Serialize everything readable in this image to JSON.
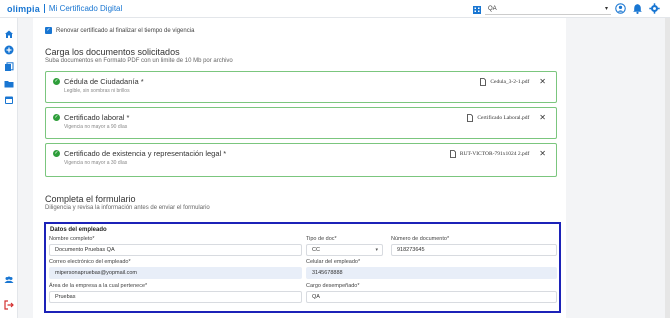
{
  "header": {
    "logo": "olimpia",
    "app_title": "Mi Certificado Digital",
    "tenant": "QA"
  },
  "renew": {
    "label": "Renovar certificado al finalizar el tiempo de vigencia",
    "checked": true
  },
  "upload": {
    "title": "Carga los documentos solicitados",
    "subtitle": "Suba documentos en Formato PDF con un limite de 10 Mb por archivo",
    "documents": [
      {
        "title": "Cédula de Ciudadanía *",
        "hint": "Legible, sin sombras ni brillos",
        "file": "Cedula_3-2-1.pdf"
      },
      {
        "title": "Certificado laboral *",
        "hint": "Vigencia no mayor a 90 días",
        "file": "Certificado Laboral.pdf"
      },
      {
        "title": "Certificado de existencia y representación legal *",
        "hint": "Vigencia no mayor a 30 días",
        "file": "RUT-VICTOR-791x1024 2.pdf"
      }
    ]
  },
  "form": {
    "title": "Completa el formulario",
    "subtitle": "Diligencia y revisa la información antes de enviar el formulario",
    "section": "Datos del empleado",
    "fields": {
      "full_name": {
        "label": "Nombre completo*",
        "value": "Documento Pruebas QA"
      },
      "doc_type": {
        "label": "Tipo de doc*",
        "value": "CC"
      },
      "doc_number": {
        "label": "Número de documento*",
        "value": "918273645"
      },
      "email": {
        "label": "Correo electrónico del empleado*",
        "value": "mipersonapruebas@yopmail.com"
      },
      "phone": {
        "label": "Celular del empleado*",
        "value": "3145678888"
      },
      "area": {
        "label": "Área de la empresa a la cual pertenece*",
        "value": "Pruebas"
      },
      "position": {
        "label": "Cargo desempeñado*",
        "value": "QA"
      }
    }
  },
  "colors": {
    "brand": "#1976d2",
    "success": "#2e9e3a",
    "highlight_border": "#1c22b8"
  }
}
